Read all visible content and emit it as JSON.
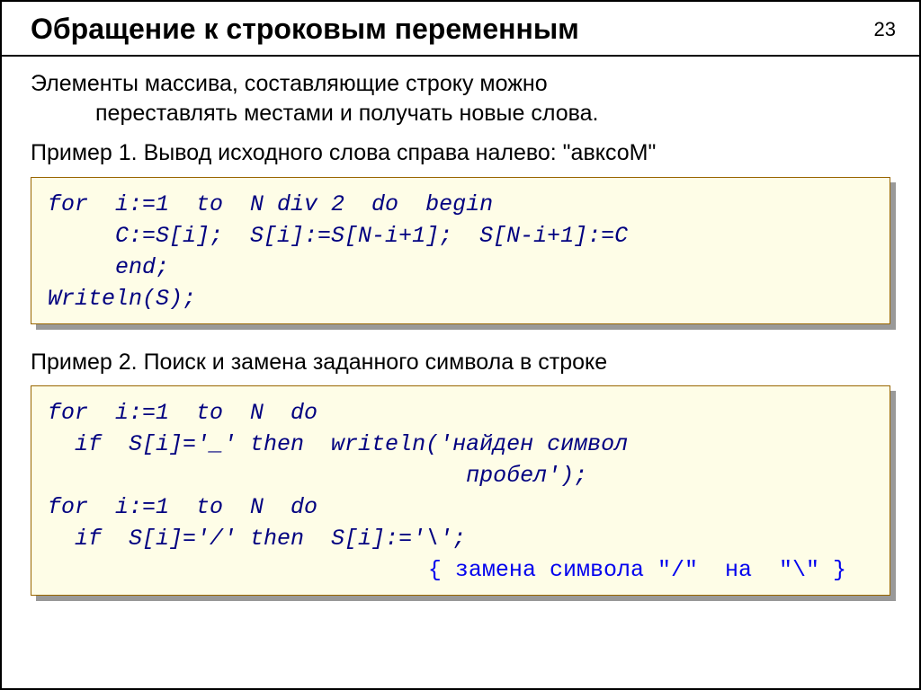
{
  "page_number": "23",
  "title": "Обращение к строковым переменным",
  "intro_line1": "Элементы массива,  составляющие строку можно",
  "intro_line2": "переставлять местами и получать новые слова.",
  "example1_label": "Пример 1. Вывод исходного слова справа налево: \"авксоМ\"",
  "code1": "for  i:=1  to  N div 2  do  begin\n     C:=S[i];  S[i]:=S[N-i+1];  S[N-i+1]:=C\n     end;\nWriteln(S);",
  "example2_label": "Пример 2. Поиск и замена заданного символа в строке",
  "code2_main": "for  i:=1  to  N  do\n  if  S[i]='_' then  writeln('найден символ\n                               пробел');\nfor  i:=1  to  N  do\n  if  S[i]='/' then  S[i]:='\\';",
  "code2_comment": "{ замена символа \"/\"  на  \"\\\" }"
}
